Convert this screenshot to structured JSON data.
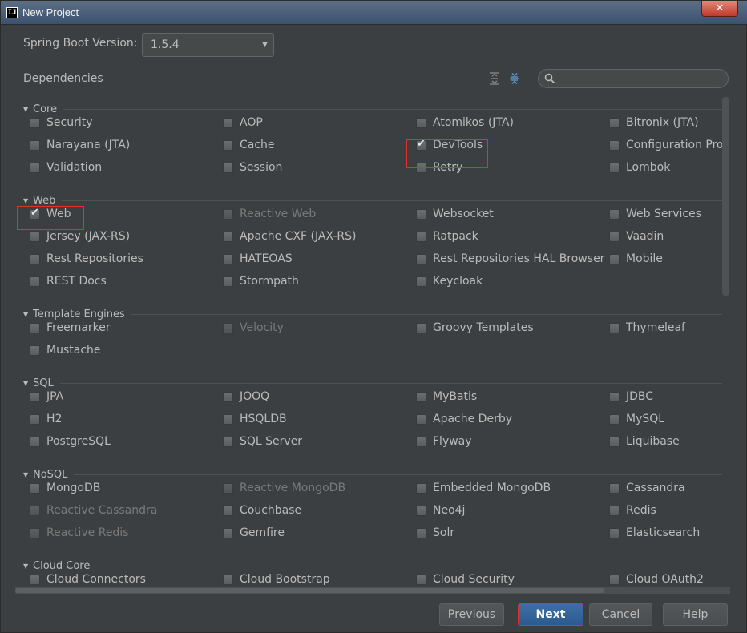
{
  "window": {
    "title": "New Project",
    "close_label": "✕"
  },
  "version": {
    "label": "Spring Boot Version:",
    "value": "1.5.4"
  },
  "deps": {
    "label": "Dependencies",
    "search_placeholder": ""
  },
  "sections": [
    {
      "name": "Core",
      "rows": [
        [
          {
            "label": "Security"
          },
          {
            "label": "AOP"
          },
          {
            "label": "Atomikos (JTA)"
          },
          {
            "label": "Bitronix (JTA)"
          }
        ],
        [
          {
            "label": "Narayana (JTA)"
          },
          {
            "label": "Cache"
          },
          {
            "label": "DevTools",
            "checked": true
          },
          {
            "label": "Configuration Processor"
          }
        ],
        [
          {
            "label": "Validation"
          },
          {
            "label": "Session"
          },
          {
            "label": "Retry"
          },
          {
            "label": "Lombok"
          }
        ]
      ]
    },
    {
      "name": "Web",
      "rows": [
        [
          {
            "label": "Web",
            "checked": true
          },
          {
            "label": "Reactive Web",
            "disabled": true
          },
          {
            "label": "Websocket"
          },
          {
            "label": "Web Services"
          }
        ],
        [
          {
            "label": "Jersey (JAX-RS)"
          },
          {
            "label": "Apache CXF (JAX-RS)"
          },
          {
            "label": "Ratpack"
          },
          {
            "label": "Vaadin"
          }
        ],
        [
          {
            "label": "Rest Repositories"
          },
          {
            "label": "HATEOAS"
          },
          {
            "label": "Rest Repositories HAL Browser"
          },
          {
            "label": "Mobile"
          }
        ],
        [
          {
            "label": "REST Docs"
          },
          {
            "label": "Stormpath"
          },
          {
            "label": "Keycloak"
          },
          null
        ]
      ]
    },
    {
      "name": "Template Engines",
      "rows": [
        [
          {
            "label": "Freemarker"
          },
          {
            "label": "Velocity",
            "disabled": true
          },
          {
            "label": "Groovy Templates"
          },
          {
            "label": "Thymeleaf"
          }
        ],
        [
          {
            "label": "Mustache"
          },
          null,
          null,
          null
        ]
      ]
    },
    {
      "name": "SQL",
      "rows": [
        [
          {
            "label": "JPA"
          },
          {
            "label": "JOOQ"
          },
          {
            "label": "MyBatis"
          },
          {
            "label": "JDBC"
          }
        ],
        [
          {
            "label": "H2"
          },
          {
            "label": "HSQLDB"
          },
          {
            "label": "Apache Derby"
          },
          {
            "label": "MySQL"
          }
        ],
        [
          {
            "label": "PostgreSQL"
          },
          {
            "label": "SQL Server"
          },
          {
            "label": "Flyway"
          },
          {
            "label": "Liquibase"
          }
        ]
      ]
    },
    {
      "name": "NoSQL",
      "rows": [
        [
          {
            "label": "MongoDB"
          },
          {
            "label": "Reactive MongoDB",
            "disabled": true
          },
          {
            "label": "Embedded MongoDB"
          },
          {
            "label": "Cassandra"
          }
        ],
        [
          {
            "label": "Reactive Cassandra",
            "disabled": true
          },
          {
            "label": "Couchbase"
          },
          {
            "label": "Neo4j"
          },
          {
            "label": "Redis"
          }
        ],
        [
          {
            "label": "Reactive Redis",
            "disabled": true
          },
          {
            "label": "Gemfire"
          },
          {
            "label": "Solr"
          },
          {
            "label": "Elasticsearch"
          }
        ]
      ]
    },
    {
      "name": "Cloud Core",
      "rows": [
        [
          {
            "label": "Cloud Connectors"
          },
          {
            "label": "Cloud Bootstrap"
          },
          {
            "label": "Cloud Security"
          },
          {
            "label": "Cloud OAuth2"
          }
        ]
      ]
    }
  ],
  "buttons": {
    "previous_pre": "",
    "previous_key": "P",
    "previous_post": "revious",
    "next_pre": "",
    "next_key": "N",
    "next_post": "ext",
    "cancel": "Cancel",
    "help": "Help"
  },
  "colors": {
    "background": "#3c3f41",
    "text": "#bbbbbb",
    "disabled_text": "#7a7a7a",
    "highlight": "#e0312b",
    "primary": "#2c5a8e"
  }
}
